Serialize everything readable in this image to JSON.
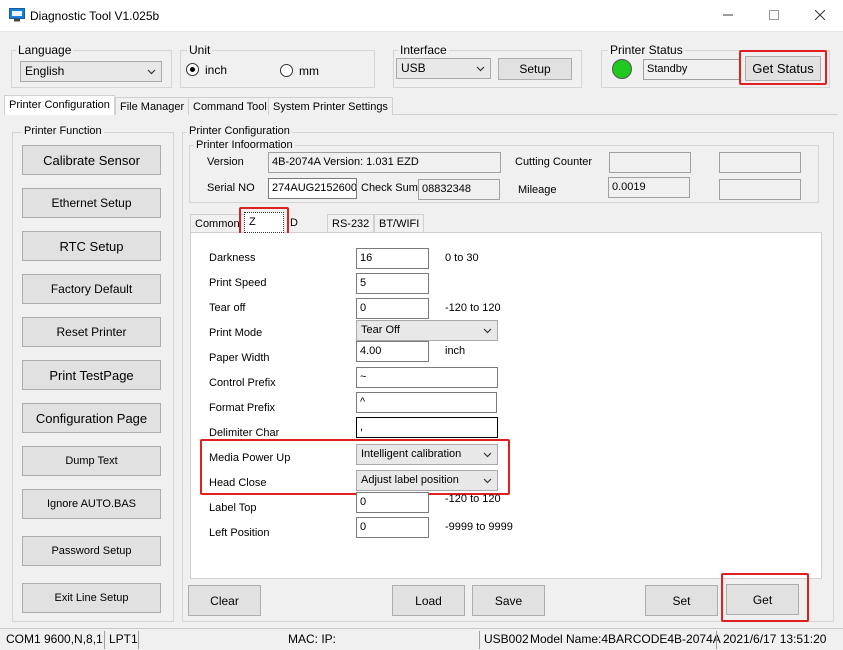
{
  "window": {
    "title": "Diagnostic Tool V1.025b"
  },
  "language": {
    "label": "Language",
    "selected": "English"
  },
  "unit": {
    "label": "Unit",
    "options": [
      "inch",
      "mm"
    ],
    "selected": "inch"
  },
  "interface": {
    "label": "Interface",
    "selected": "USB",
    "setup_button": "Setup"
  },
  "printer_status": {
    "label": "Printer  Status",
    "indicator_color": "#1ec81e",
    "status_text": "Standby",
    "get_status_button": "Get Status"
  },
  "main_tabs": [
    "Printer Configuration",
    "File Manager",
    "Command Tool",
    "System Printer Settings"
  ],
  "printer_function": {
    "label": "Printer  Function",
    "buttons": [
      "Calibrate Sensor",
      "Ethernet Setup",
      "RTC Setup",
      "Factory Default",
      "Reset Printer",
      "Print TestPage",
      "Configuration Page",
      "Dump Text",
      "Ignore AUTO.BAS",
      "Password Setup",
      "Exit Line Setup"
    ]
  },
  "printer_configuration": {
    "label": "Printer Configuration",
    "info_label": "Printer Infoormation",
    "version_label": "Version",
    "version_value": "4B-2074A Version: 1.031 EZD",
    "serial_label": "Serial NO",
    "serial_value": "274AUG2152600",
    "checksum_label": "Check Sum",
    "checksum_value": "08832348",
    "cutting_counter_label": "Cutting Counter",
    "cutting_counter_value": "",
    "mileage_label": "Mileage",
    "mileage_value": "0.0019"
  },
  "sub_tabs": [
    "Common",
    "Z",
    "D",
    "RS-232",
    "BT/WIFI"
  ],
  "settings": {
    "darkness_label": "Darkness",
    "darkness_value": "16",
    "darkness_range": "0 to 30",
    "print_speed_label": "Print Speed",
    "print_speed_value": "5",
    "tear_off_label": "Tear  off",
    "tear_off_value": "0",
    "tear_off_range": "-120 to 120",
    "print_mode_label": "Print Mode",
    "print_mode_value": "Tear Off",
    "paper_width_label": "Paper Width",
    "paper_width_value": "4.00",
    "paper_width_unit": "inch",
    "control_prefix_label": "Control Prefix",
    "control_prefix_value": "~",
    "format_prefix_label": "Format Prefix",
    "format_prefix_value": "^",
    "delimiter_char_label": "Delimiter Char",
    "delimiter_char_value": ",",
    "media_power_up_label": "Media Power Up",
    "media_power_up_value": "Intelligent calibration",
    "head_close_label": "Head Close",
    "head_close_value": "Adjust label position",
    "label_top_label": "Label Top",
    "label_top_value": "0",
    "label_top_range": "-120 to 120",
    "left_position_label": "Left Position",
    "left_position_value": "0",
    "left_position_range": "-9999 to 9999"
  },
  "bottom_buttons": {
    "clear": "Clear",
    "load": "Load",
    "save": "Save",
    "set": "Set",
    "get": "Get"
  },
  "statusbar": {
    "port": "COM1 9600,N,8,1",
    "lpt": "LPT1",
    "mac": "MAC: IP:",
    "usb": "USB002",
    "model": "Model Name:4BARCODE4B-2074A",
    "datetime": "2021/6/17 13:51:20"
  },
  "colors": {
    "highlight": "#e02020"
  }
}
